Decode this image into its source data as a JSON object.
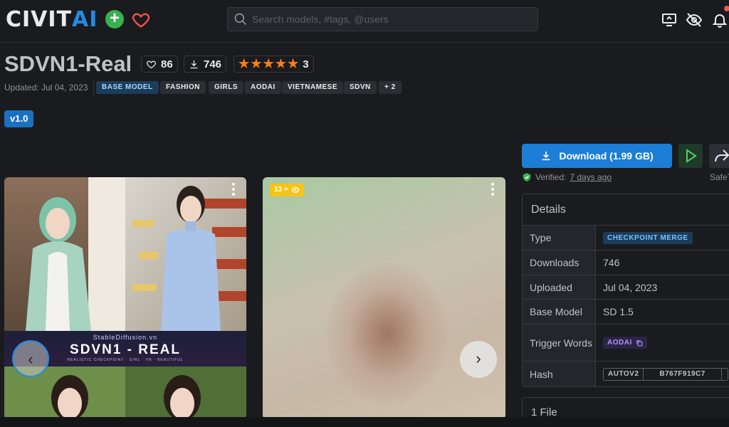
{
  "header": {
    "logo_part1": "CIVIT",
    "logo_part2": "AI",
    "add_label": "+",
    "search_placeholder": "Search models, #tags, @users"
  },
  "model": {
    "title": "SDVN1-Real",
    "likes": "86",
    "downloads": "746",
    "rating_count": "3",
    "rating_stars": 5,
    "updated": "Updated: Jul 04, 2023",
    "base_tag": "BASE MODEL",
    "tags": [
      "FASHION",
      "GIRLS",
      "AODAI",
      "VIETNAMESE",
      "SDVN",
      "+ 2"
    ],
    "version": "v1.0"
  },
  "gallery": {
    "card1_title": "SDVN1 - REAL",
    "card1_subtitle": "StableDiffusion.vn",
    "card1_tagline": "REALISTIC CHECKPOINT · GIRL · VN · BEAUTIFUL",
    "nsfw_badge": "13 +",
    "prev_label": "‹",
    "next_label": "›"
  },
  "actions": {
    "download_label": "Download (1.99 GB)",
    "verified_prefix": "Verified:",
    "verified_time": "7 days ago",
    "safe_text": "SafeT"
  },
  "details": {
    "heading": "Details",
    "rows": [
      {
        "key": "Type",
        "value": "CHECKPOINT MERGE"
      },
      {
        "key": "Downloads",
        "value": "746"
      },
      {
        "key": "Uploaded",
        "value": "Jul 04, 2023"
      },
      {
        "key": "Base Model",
        "value": "SD 1.5"
      },
      {
        "key": "Trigger Words",
        "value": "AODAI"
      },
      {
        "key": "Hash",
        "value": "AUTOV2"
      }
    ],
    "hash_value": "B767F919C7"
  },
  "files": {
    "heading": "1 File"
  },
  "colors": {
    "accent": "#1c7ed6",
    "background": "#1a1b1e",
    "star": "#fd7e14"
  }
}
